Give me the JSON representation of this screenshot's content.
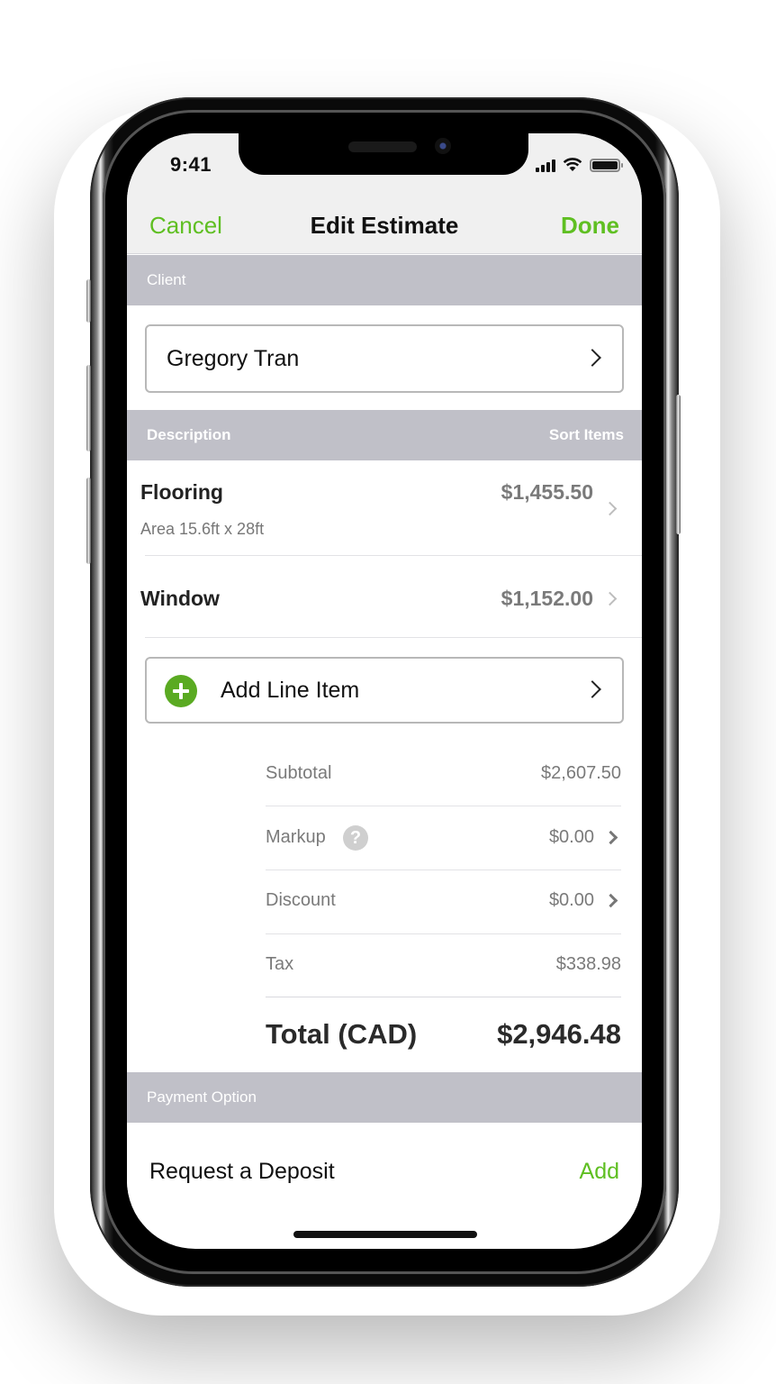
{
  "status_bar": {
    "time": "9:41",
    "icons": [
      "cellular-signal-icon",
      "wifi-icon",
      "battery-icon"
    ]
  },
  "nav": {
    "cancel_label": "Cancel",
    "title": "Edit Estimate",
    "done_label": "Done"
  },
  "client_section": {
    "header": "Client",
    "client_name": "Gregory Tran"
  },
  "description_section": {
    "header": "Description",
    "sort_label": "Sort Items",
    "items": [
      {
        "name": "Flooring",
        "detail": "Area 15.6ft x 28ft",
        "price": "$1,455.50"
      },
      {
        "name": "Window",
        "price": "$1,152.00"
      }
    ],
    "add_line_item_label": "Add Line Item"
  },
  "summary": {
    "subtotal_label": "Subtotal",
    "subtotal_value": "$2,607.50",
    "markup_label": "Markup",
    "markup_value": "$0.00",
    "markup_help_glyph": "?",
    "discount_label": "Discount",
    "discount_value": "$0.00",
    "tax_label": "Tax",
    "tax_value": "$338.98",
    "total_label": "Total (CAD)",
    "total_value": "$2,946.48"
  },
  "payment_section": {
    "header": "Payment Option",
    "deposit_label": "Request a Deposit",
    "deposit_action": "Add"
  },
  "colors": {
    "accent_green": "#5fbf22",
    "section_header_gray": "#c0c0c8",
    "add_icon_green": "#5aaa22"
  }
}
